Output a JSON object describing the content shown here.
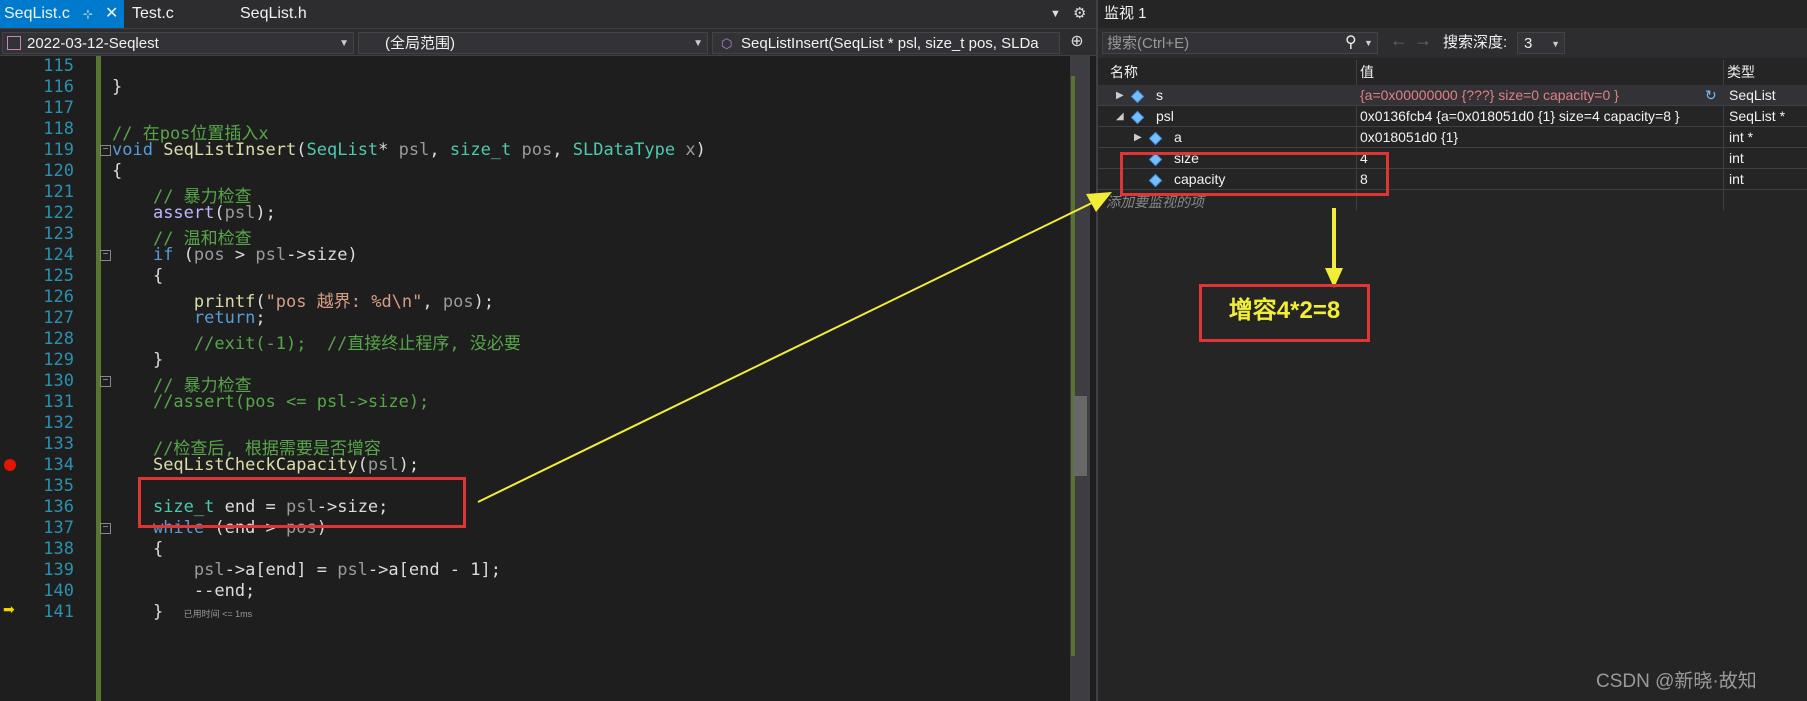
{
  "tabs": [
    {
      "label": "SeqList.c",
      "active": true
    },
    {
      "label": "Test.c",
      "active": false
    },
    {
      "label": "SeqList.h",
      "active": false
    }
  ],
  "navbar": {
    "project": "2022-03-12-Seqlest",
    "scope": "(全局范围)",
    "function": "SeqListInsert(SeqList * psl, size_t pos, SLDa"
  },
  "editor": {
    "line_numbers": [
      "115",
      "116",
      "117",
      "118",
      "119",
      "120",
      "121",
      "122",
      "123",
      "124",
      "125",
      "126",
      "127",
      "128",
      "129",
      "130",
      "131",
      "132",
      "133",
      "134",
      "135",
      "136",
      "137",
      "138",
      "139",
      "140",
      "141"
    ],
    "perf_tip": "已用时间 <= 1ms",
    "breakpoint_line": "134",
    "current_line": "141"
  },
  "watch": {
    "title": "监视 1",
    "search_placeholder": "搜索(Ctrl+E)",
    "depth_label": "搜索深度:",
    "depth_value": "3",
    "columns": {
      "name": "名称",
      "value": "值",
      "type": "类型"
    },
    "rows": [
      {
        "name": "s",
        "value": "{a=0x00000000 {???} size=0 capacity=0 }",
        "type": "SeqList"
      },
      {
        "name": "psl",
        "value": "0x0136fcb4 {a=0x018051d0 {1} size=4 capacity=8 }",
        "type": "SeqList *"
      },
      {
        "name": "a",
        "value": "0x018051d0 {1}",
        "type": "int *"
      },
      {
        "name": "size",
        "value": "4",
        "type": "int"
      },
      {
        "name": "capacity",
        "value": "8",
        "type": "int"
      }
    ],
    "add_item": "添加要监视的项"
  },
  "annotation": {
    "callout": "增容4*2=8"
  },
  "watermark": "CSDN @新晓·故知",
  "colors": {
    "accent": "#007acc",
    "annotation_arrow": "#f2ee38",
    "annotation_box": "#e03535"
  }
}
